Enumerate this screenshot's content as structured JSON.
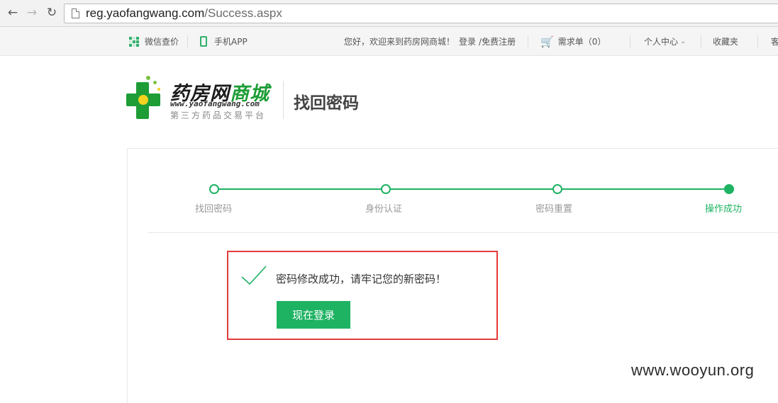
{
  "browser": {
    "back_icon": "arrow-left-icon",
    "forward_icon": "arrow-right-icon",
    "reload_icon": "reload-icon",
    "url_host": "reg.yaofangwang.com",
    "url_path": "/Success.aspx"
  },
  "topbar": {
    "wechat_label": "微信查价",
    "app_label": "手机APP",
    "welcome_text": "您好，欢迎来到药房网商城！",
    "login_label": "登录",
    "register_label": "/免费注册",
    "cart_label": "需求单（0）",
    "personal_center_label": "个人中心",
    "favorites_label": "收藏夹",
    "more_label": "客"
  },
  "header": {
    "logo_title_black": "药房网",
    "logo_title_green": "商城",
    "logo_url": "www.yaofangwang.com",
    "logo_subtitle": "第三方药品交易平台",
    "page_title": "找回密码"
  },
  "steps": [
    {
      "label": "找回密码",
      "state": "done"
    },
    {
      "label": "身份认证",
      "state": "done"
    },
    {
      "label": "密码重置",
      "state": "done"
    },
    {
      "label": "操作成功",
      "state": "current"
    }
  ],
  "result": {
    "message": "密码修改成功，请牢记您的新密码！",
    "login_button": "现在登录"
  },
  "watermark": "www.wooyun.org",
  "colors": {
    "accent_green": "#1eb363",
    "highlight_red": "#e43b3b",
    "cart_red": "#e60012"
  }
}
